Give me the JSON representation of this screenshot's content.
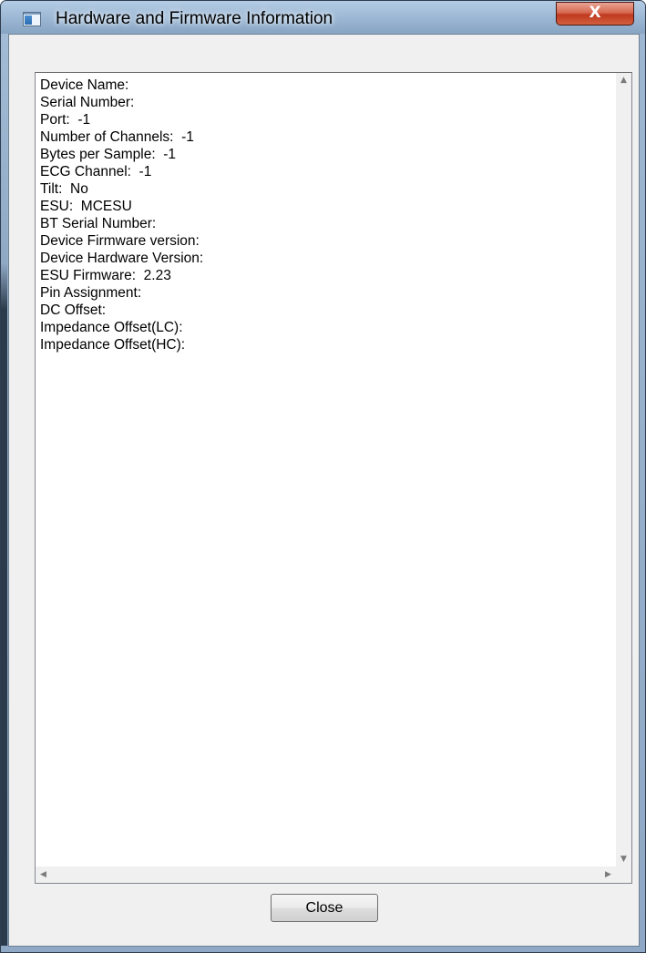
{
  "window": {
    "title": "Hardware and Firmware Information",
    "close_glyph": "X"
  },
  "info_text": {
    "lines": [
      "Device Name:",
      "Serial Number:",
      "Port:  -1",
      "Number of Channels:  -1",
      "Bytes per Sample:  -1",
      "ECG Channel:  -1",
      "Tilt:  No",
      "ESU:  MCESU",
      "BT Serial Number:",
      "Device Firmware version:",
      "Device Hardware Version:",
      "ESU Firmware:  2.23",
      "Pin Assignment:",
      "DC Offset:",
      "Impedance Offset(LC):",
      "Impedance Offset(HC):"
    ]
  },
  "scrollbars": {
    "up_glyph": "▲",
    "down_glyph": "▼",
    "left_glyph": "◀",
    "right_glyph": "▶"
  },
  "buttons": {
    "close_label": "Close"
  },
  "icons": {
    "window_icon": "window-app-icon",
    "close": "close-icon"
  },
  "colors": {
    "titlebar": "#9bb6d3",
    "close_button": "#c0391f",
    "client_bg": "#f0f0f0"
  }
}
